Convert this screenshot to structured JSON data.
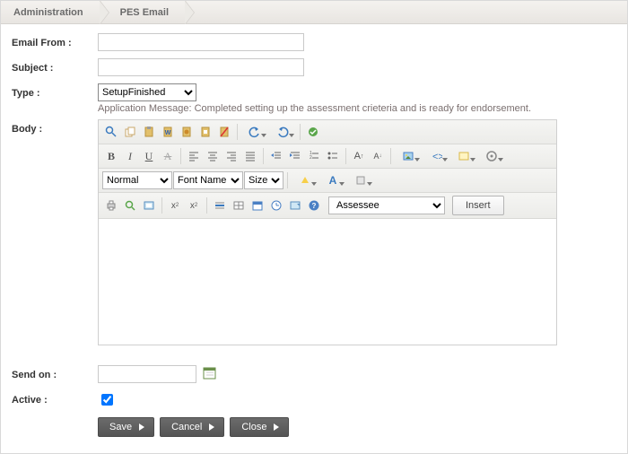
{
  "breadcrumb": {
    "items": [
      "Administration",
      "PES Email"
    ]
  },
  "labels": {
    "email_from": "Email From :",
    "subject": "Subject :",
    "type": "Type :",
    "body": "Body :",
    "send_on": "Send on :",
    "active": "Active :"
  },
  "fields": {
    "email_from": "",
    "subject": "",
    "type_selected": "SetupFinished",
    "send_on": "",
    "active_checked": true
  },
  "app_message": "Application Message: Completed setting up the assessment crieteria and is ready for endorsement.",
  "editor": {
    "style_dd": "Normal",
    "font_placeholder": "Font Name",
    "size_placeholder": "Size",
    "insert_field_selected": "Assessee",
    "insert_btn": "Insert"
  },
  "buttons": {
    "save": "Save",
    "cancel": "Cancel",
    "close": "Close"
  }
}
